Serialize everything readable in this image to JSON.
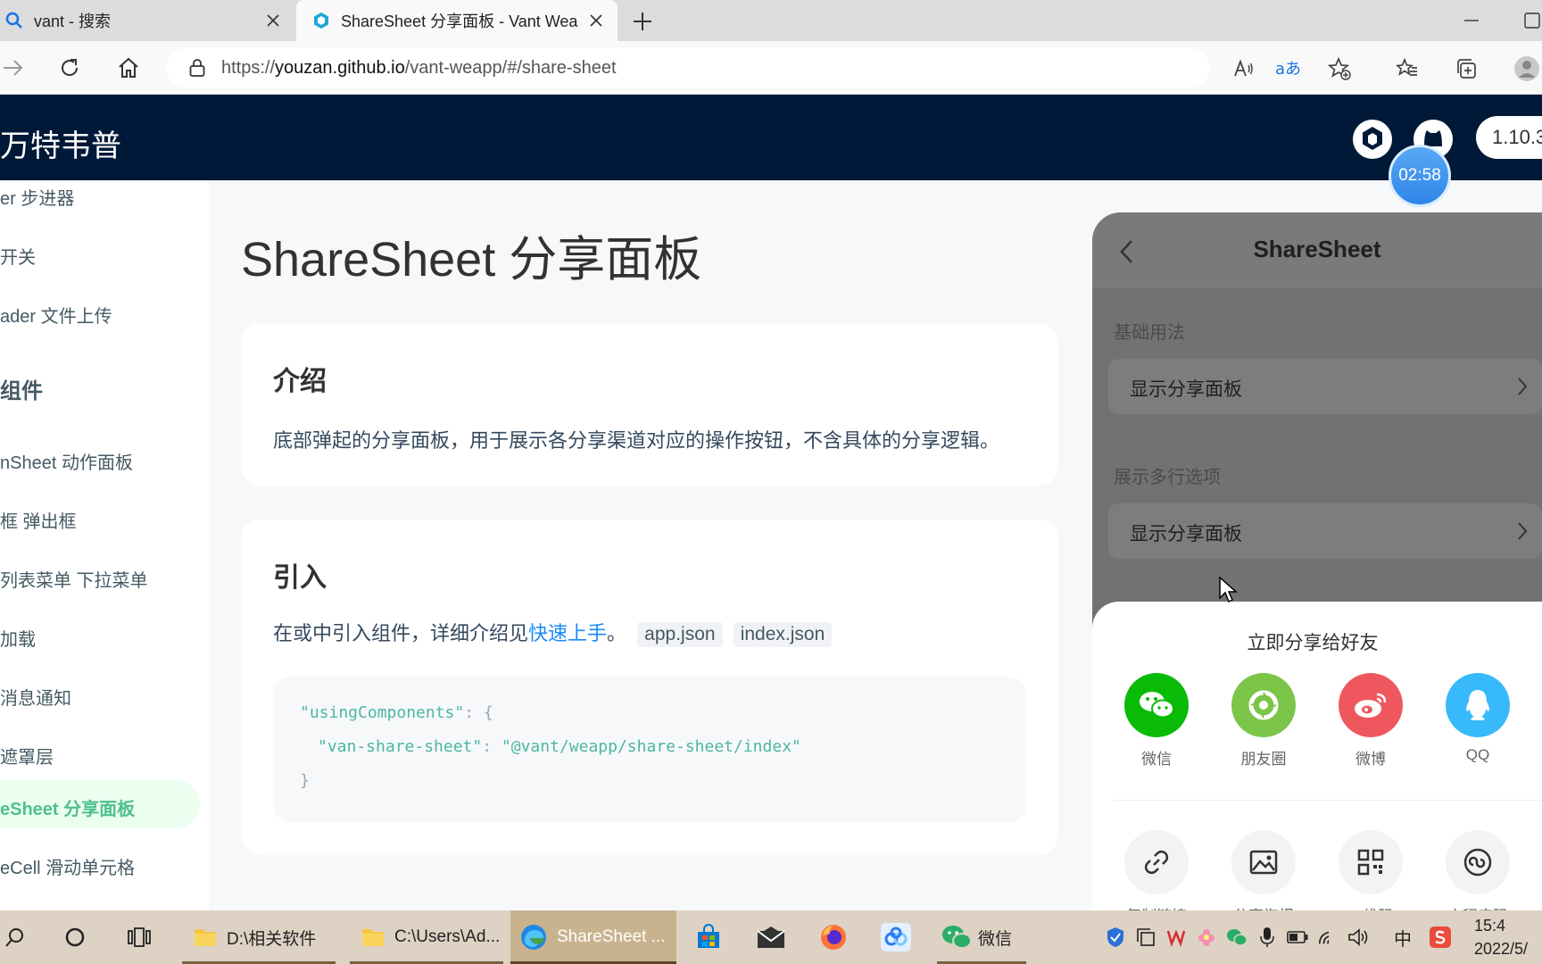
{
  "browser": {
    "tabs": [
      {
        "title": "vant - 搜索",
        "active": false
      },
      {
        "title": "ShareSheet 分享面板 - Vant Wea",
        "active": true
      }
    ],
    "url_prefix": "https://",
    "url_host": "youzan.github.io",
    "url_path": "/vant-weapp/#/share-sheet"
  },
  "site": {
    "brand": "万特韦普",
    "version": "1.10.3",
    "timer": "02:58"
  },
  "sidebar": {
    "items": [
      {
        "label": "er 步进器"
      },
      {
        "label": "开关"
      },
      {
        "label": "ader 文件上传"
      },
      {
        "label": "组件",
        "group": true
      },
      {
        "label": "nSheet 动作面板"
      },
      {
        "label": "框 弹出框"
      },
      {
        "label": "列表菜单 下拉菜单"
      },
      {
        "label": "加载"
      },
      {
        "label": "消息通知"
      },
      {
        "label": "遮罩层"
      },
      {
        "label": "eSheet 分享面板",
        "active": true
      },
      {
        "label": "eCell 滑动单元格"
      }
    ]
  },
  "main": {
    "title": "ShareSheet 分享面板",
    "intro": {
      "heading": "介绍",
      "text": "底部弹起的分享面板，用于展示各分享渠道对应的操作按钮，不含具体的分享逻辑。"
    },
    "import": {
      "heading": "引入",
      "text_before": "在或中引入组件，详细介绍见",
      "link": "快速上手",
      "text_after": "。",
      "code1": "app.json",
      "code2": "index.json",
      "code_lines": {
        "l1_key": "\"usingComponents\"",
        "l1_rest": ": {",
        "l2_key": "\"van-share-sheet\"",
        "l2_sep": ": ",
        "l2_val": "\"@vant/weapp/share-sheet/index\"",
        "l3": "}"
      }
    }
  },
  "phone": {
    "title": "ShareSheet",
    "section1": "基础用法",
    "cell1": "显示分享面板",
    "section2": "展示多行选项",
    "cell2": "显示分享面板",
    "sheet": {
      "title": "立即分享给好友",
      "row1": [
        {
          "label": "微信",
          "color": "#09bb07",
          "icon": "wechat-icon"
        },
        {
          "label": "朋友圈",
          "color": "#7bc549",
          "icon": "moments-icon"
        },
        {
          "label": "微博",
          "color": "#ee575e",
          "icon": "weibo-icon"
        },
        {
          "label": "QQ",
          "color": "#38b9fa",
          "icon": "qq-icon"
        }
      ],
      "row2": [
        {
          "label": "复制链接",
          "icon": "link-icon"
        },
        {
          "label": "分享海报",
          "icon": "image-icon"
        },
        {
          "label": "二维码",
          "icon": "qrcode-icon"
        },
        {
          "label": "小程序码",
          "icon": "miniprogram-icon"
        }
      ]
    }
  },
  "taskbar": {
    "items": [
      {
        "label": "D:\\相关软件"
      },
      {
        "label": "C:\\Users\\Ad..."
      },
      {
        "label": "ShareSheet ...",
        "active": true
      },
      {
        "label": "微信"
      }
    ],
    "ime": "中",
    "time": "15:4",
    "date": "2022/5/"
  }
}
